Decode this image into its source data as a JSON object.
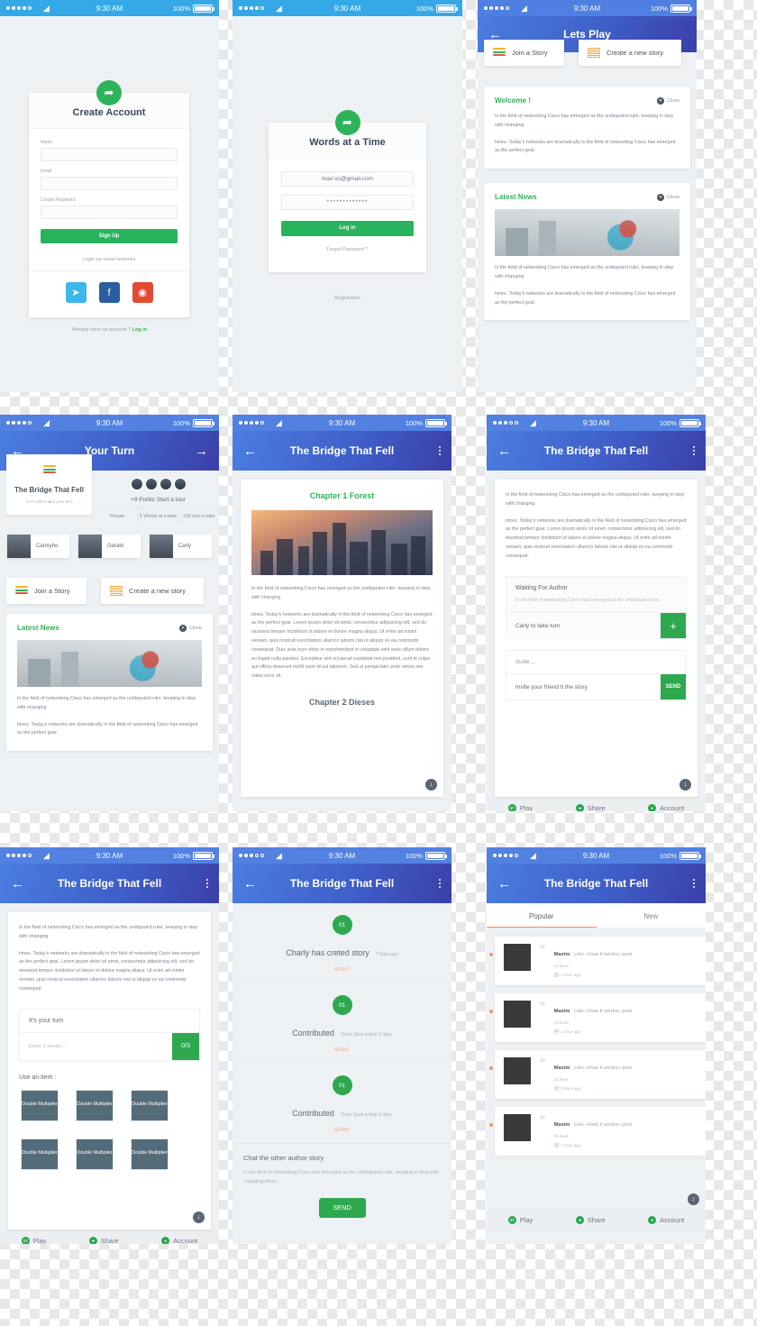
{
  "statusbar": {
    "time": "9:30 AM",
    "battery": "100%",
    "wifi_icon": "wifi-icon"
  },
  "common": {
    "body_p1": "In the field of networking Cisco has emerged as the  undisputed ruler, keeping in step with changing",
    "body_p2": "times. Today's networks are dramatically in the field of networking Cisco has emerged as the perfect goal.",
    "lorem_long": "times. Today's networks are dramatically in the field of networking Cisco has emerged as the perfect goal. Lorem ipsum dolor sit amet, consectetur adipisicing elit, sed do eiusmod tempor incididunt ut labore et dolore magna aliqua. Ut enim ad minim veniam, quis nostrud exercitation ullamco laboris nisi ut aliquip ex ea commodo consequat.",
    "lorem_longer": "times. Today's networks are dramatically in the field of networking Cisco has emerged as the perfect goal. Lorem ipsum dolor sit amet, consectetur adipisicing elit, sed do eiusmod tempor incididunt ut labore et dolore magna aliqua. Ut enim ad minim veniam, quis nostrud exercitation ullamco laboris nisi ut aliquip ex ea commodo consequat. Duis aute irure dolor in reprehenderit in voluptate velit esse cillum dolore eu fugiat nulla pariatur. Excepteur sint occaecat cupidatat non proident, sunt in culpa qui officia deserunt mollit anim id est laborum. Sed ut perspiciatis unde omnis iste natus error sit.",
    "join_story": "Join a Story",
    "create_story": "Create a new story",
    "close": "Close",
    "tabbar": [
      {
        "label": "Play",
        "badge": "17",
        "icon": "play-icon"
      },
      {
        "label": "Share",
        "badge": "",
        "icon": "share-icon"
      },
      {
        "label": "Account",
        "badge": "",
        "icon": "account-icon"
      }
    ],
    "scroll_down_icon": "arrow-down-icon"
  },
  "screen1_signup": {
    "title": "Create Account",
    "cursor_icon": "cursor-icon",
    "fields": [
      {
        "label": "Name",
        "value": "",
        "placeholder": ""
      },
      {
        "label": "Email",
        "value": "",
        "placeholder": ""
      },
      {
        "label": "Create Password",
        "value": "",
        "placeholder": ""
      }
    ],
    "signup_button": "Sign Up",
    "social_label": "Login via social networks",
    "socials": [
      {
        "name": "twitter-icon",
        "glyph": "❧",
        "color": "#3cb7ea"
      },
      {
        "name": "facebook-icon",
        "glyph": "f",
        "color": "#2b5e9e"
      },
      {
        "name": "dribbble-icon",
        "glyph": "◉",
        "color": "#e04b32"
      }
    ],
    "footer_text": "Already have an account ?",
    "footer_link": "Log in"
  },
  "screen2_login": {
    "title": "Words at a Time",
    "cursor_icon": "cursor-icon",
    "email_value": "max-vc@gmail.com",
    "password_value": "*************",
    "login_button": "Log in",
    "forgot": "Forgot Password ?",
    "registration": "Registration"
  },
  "screen3_letsplay": {
    "nav_title": "Lets Play",
    "back_icon": "arrow-left-icon",
    "welcome_title": "Welcome !",
    "news_title": "Latest News"
  },
  "screen4_yourturn": {
    "nav_title": "Your Turn",
    "back_icon": "arrow-left-icon",
    "forward_icon": "arrow-right-icon",
    "story_title": "The Bridge That Fell",
    "story_sub": "2 Hr Left to take your turn",
    "participants": "+9 Public Start a tour",
    "meta": [
      "Private",
      "5 Words at a time",
      "192 turn a take"
    ],
    "players": [
      "Carmyho",
      "Gerald",
      "Carly"
    ],
    "news_title": "Latest News"
  },
  "screen5_story": {
    "nav_title": "The Bridge That Fell",
    "back_icon": "arrow-left-icon",
    "menu_icon": "more-vertical-icon",
    "chapter1": "Chapter 1 Forest",
    "chapter2": "Chapter 2 Dieses"
  },
  "screen6_waiting": {
    "nav_title": "The Bridge That Fell",
    "back_icon": "arrow-left-icon",
    "menu_icon": "more-vertical-icon",
    "waiting_title": "Waiting For Author",
    "waiting_sub": "In the field of networking Cisco has emerged as the undisputed ruler,.",
    "turn_text": "Carly to take turn",
    "plus_button": "+",
    "invite_title": "Invite....",
    "invite_text": "Invite your friend ti the story",
    "send_button": "SEND"
  },
  "screen7_yourturninput": {
    "nav_title": "The Bridge That Fell",
    "back_icon": "arrow-left-icon",
    "menu_icon": "more-vertical-icon",
    "turn_title": "It's your turn",
    "input_placeholder": "Enter 3 words ,..",
    "counter": "0/3",
    "items_label": "Use an item :",
    "items": [
      "Double Multiplier",
      "Double Multiplier",
      "Double Multiplier",
      "Double Multiplier",
      "Double Multiplier",
      "Double Multiplier"
    ]
  },
  "screen8_activity": {
    "nav_title": "The Bridge That Fell",
    "back_icon": "arrow-left-icon",
    "menu_icon": "more-vertical-icon",
    "timeline": [
      {
        "node": "01",
        "title": "Charly has creted story",
        "time": "7 days ago",
        "tag": "NEWS"
      },
      {
        "node": "01",
        "title": "Contributed",
        "time": "Onec Upon a time 3 days",
        "tag": "NEWS"
      },
      {
        "node": "01",
        "title": "Contributed",
        "time": "Onec Upon a time 3 days",
        "tag": "NEWS"
      }
    ],
    "chat_title": "Chat the other author story",
    "chat_text": "In the field of networking Cisco has emerged as the undisputed ruler, keeping in step with changing times.",
    "send_button": "SEND"
  },
  "screen9_feed": {
    "nav_title": "The Bridge That Fell",
    "back_icon": "arrow-left-icon",
    "menu_icon": "more-vertical-icon",
    "tabs": [
      {
        "label": "Popular",
        "active": true
      },
      {
        "label": "New",
        "active": false
      }
    ],
    "items": [
      {
        "user": "Maxim",
        "action": "Like «How it works» post",
        "likes": "23 likes",
        "time": "1 hour ago",
        "heart_icon": "heart-icon",
        "clock_icon": "clock-icon"
      },
      {
        "user": "Maxim",
        "action": "Like «How it works» post",
        "likes": "23 likes",
        "time": "1 hour ago",
        "heart_icon": "heart-icon",
        "clock_icon": "clock-icon"
      },
      {
        "user": "Maxim",
        "action": "Like «How it works» post",
        "likes": "23 likes",
        "time": "1 hour ago",
        "heart_icon": "heart-icon",
        "clock_icon": "clock-icon"
      },
      {
        "user": "Maxim",
        "action": "Like «How it works» post",
        "likes": "23 likes",
        "time": "1 hour ago",
        "heart_icon": "heart-icon",
        "clock_icon": "clock-icon"
      }
    ]
  },
  "colors": {
    "accent_green": "#28b45c",
    "nav_blue": "#3f5fc9",
    "status_blue": "#35a9e8",
    "orange": "#f08a61",
    "slate": "#546b7a"
  }
}
